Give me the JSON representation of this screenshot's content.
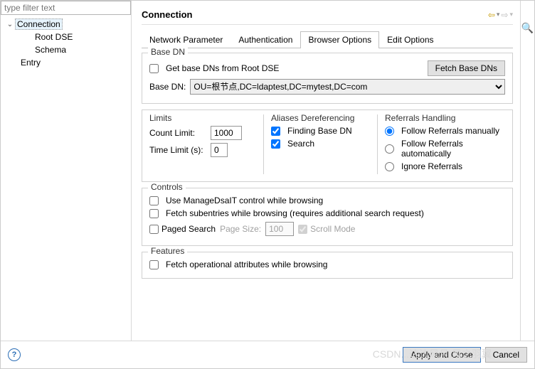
{
  "filter_placeholder": "type filter text",
  "tree": {
    "expand_glyph": "⌄",
    "items": [
      "Connection",
      "Root DSE",
      "Schema",
      "Entry"
    ]
  },
  "header": {
    "title": "Connection"
  },
  "tabs": [
    "Network Parameter",
    "Authentication",
    "Browser Options",
    "Edit Options"
  ],
  "baseDN": {
    "legend": "Base DN",
    "get_from_root": "Get base DNs from Root DSE",
    "fetch_btn": "Fetch Base DNs",
    "label": "Base DN:",
    "value": "OU=根节点,DC=ldaptest,DC=mytest,DC=com"
  },
  "limits": {
    "legend": "Limits",
    "count_label": "Count Limit:",
    "count_value": "1000",
    "time_label": "Time Limit (s):",
    "time_value": "0"
  },
  "aliases": {
    "legend": "Aliases Dereferencing",
    "finding": "Finding Base DN",
    "search": "Search"
  },
  "referrals": {
    "legend": "Referrals Handling",
    "manual": "Follow Referrals manually",
    "auto": "Follow Referrals automatically",
    "ignore": "Ignore Referrals"
  },
  "controls": {
    "legend": "Controls",
    "managedsait": "Use ManageDsaIT control while browsing",
    "subentries": "Fetch subentries while browsing (requires additional search request)",
    "paged": "Paged Search",
    "page_size_label": "Page Size:",
    "page_size_value": "100",
    "scroll": "Scroll Mode"
  },
  "features": {
    "legend": "Features",
    "op_attrs": "Fetch operational attributes while browsing"
  },
  "footer": {
    "apply_close": "Apply and Close",
    "cancel": "Cancel"
  },
  "watermark": "CSDN...达边风月.风之羽翼"
}
